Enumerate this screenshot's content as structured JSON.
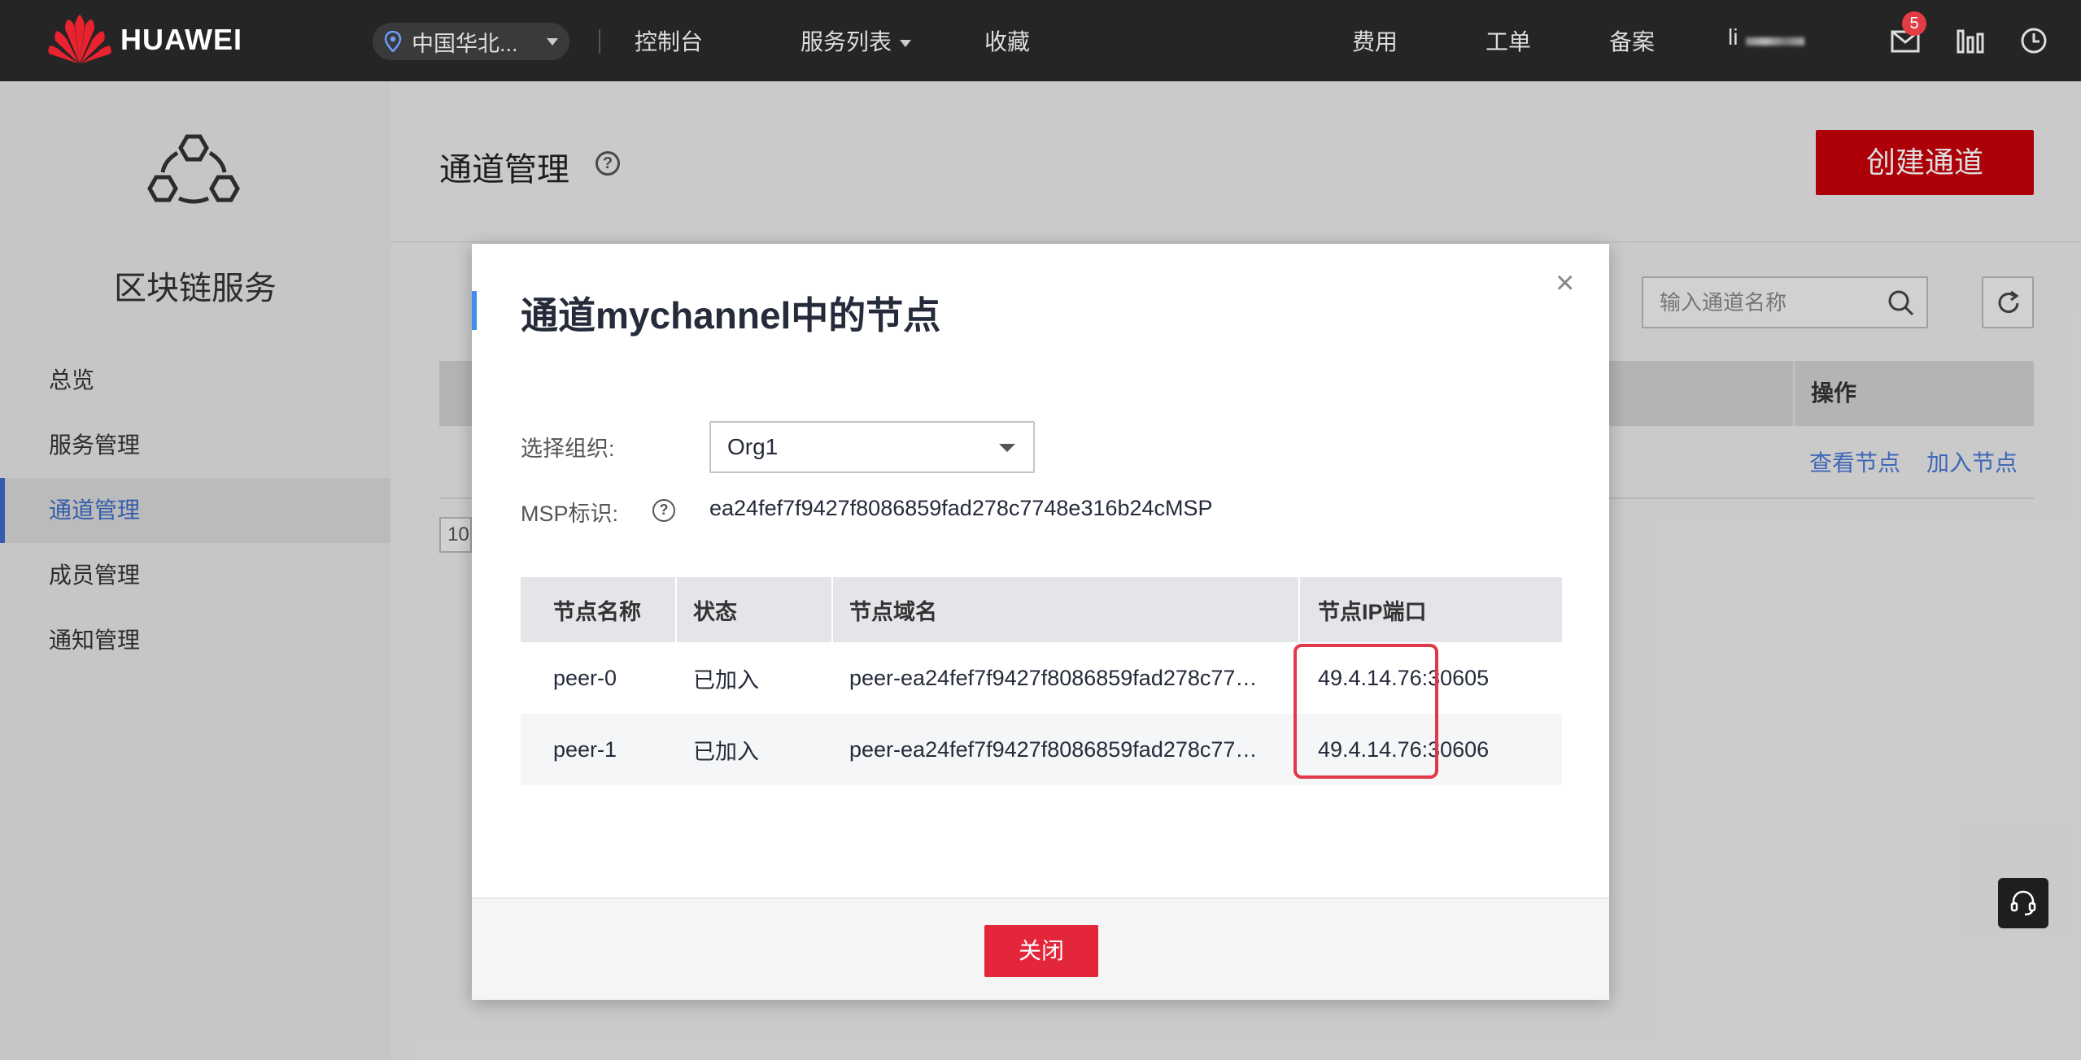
{
  "topbar": {
    "brand": "HUAWEI",
    "region": "中国华北...",
    "nav": {
      "console": "控制台",
      "services": "服务列表",
      "favorites": "收藏",
      "billing": "费用",
      "tickets": "工单",
      "icp": "备案",
      "user": "li"
    },
    "message_count": "5",
    "icons": [
      "location-pin-icon",
      "caret-down-icon",
      "mail-icon",
      "stats-icon",
      "clock-icon"
    ]
  },
  "sidebar": {
    "title": "区块链服务",
    "items": [
      {
        "label": "总览"
      },
      {
        "label": "服务管理"
      },
      {
        "label": "通道管理",
        "active": true
      },
      {
        "label": "成员管理"
      },
      {
        "label": "通知管理"
      }
    ]
  },
  "page": {
    "title": "通道管理",
    "create_button": "创建通道",
    "search_placeholder": "输入通道名称",
    "table_header_ops": "操作",
    "row_actions": [
      "查看节点",
      "加入节点"
    ],
    "page_size": "10"
  },
  "modal": {
    "title": "通道mychannel中的节点",
    "close_glyph": "×",
    "org_label": "选择组织:",
    "org_value": "Org1",
    "msp_label": "MSP标识:",
    "msp_value": "ea24fef7f9427f8086859fad278c7748e316b24cMSP",
    "columns": [
      "节点名称",
      "状态",
      "节点域名",
      "节点IP端口"
    ],
    "rows": [
      {
        "name": "peer-0",
        "status": "已加入",
        "domain": "peer-ea24fef7f9427f8086859fad278c77…",
        "ip": "49.4.14.76:30605"
      },
      {
        "name": "peer-1",
        "status": "已加入",
        "domain": "peer-ea24fef7f9427f8086859fad278c77…",
        "ip": "49.4.14.76:30606"
      }
    ],
    "close_button": "关闭"
  },
  "colors": {
    "brand_red": "#c7000b",
    "link_blue": "#4a77d4",
    "highlight_red": "#e2394a"
  }
}
